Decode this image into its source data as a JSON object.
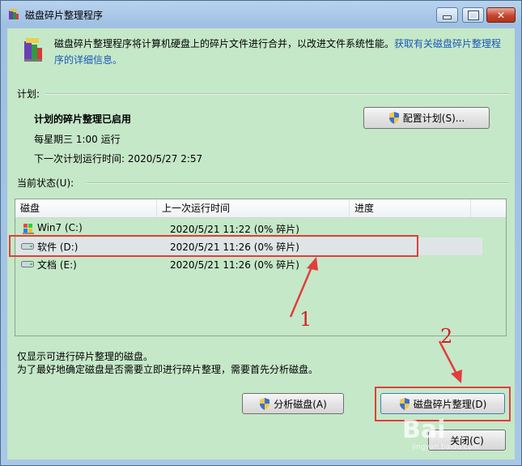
{
  "window": {
    "title": "磁盘碎片整理程序"
  },
  "description": {
    "text": "磁盘碎片整理程序将计算机硬盘上的碎片文件进行合并，以改进文件系统性能。",
    "link": "获取有关磁盘碎片整理程序的详细信息。"
  },
  "schedule": {
    "section_label": "计划:",
    "status": "计划的碎片整理已启用",
    "frequency": "每星期三  1:00 运行",
    "next_run": "下一次计划运行时间: 2020/5/27 2:57",
    "configure_button": "配置计划(S)..."
  },
  "current_status": {
    "section_label": "当前状态(U):",
    "columns": [
      "磁盘",
      "上一次运行时间",
      "进度"
    ],
    "rows": [
      {
        "disk": "Win7 (C:)",
        "last_run": "2020/5/21 11:22 (0% 碎片)",
        "progress": ""
      },
      {
        "disk": "软件 (D:)",
        "last_run": "2020/5/21 11:26 (0% 碎片)",
        "progress": ""
      },
      {
        "disk": "文档 (E:)",
        "last_run": "2020/5/21 11:26 (0% 碎片)",
        "progress": ""
      }
    ],
    "selected_row": 1
  },
  "notes": {
    "line1": "仅显示可进行碎片整理的磁盘。",
    "line2": "为了最好地确定磁盘是否需要立即进行碎片整理，需要首先分析磁盘。"
  },
  "buttons": {
    "analyze": "分析磁盘(A)",
    "defrag": "磁盘碎片整理(D)",
    "close": "关闭(C)"
  },
  "annotations": {
    "one": "1",
    "two": "2"
  },
  "watermark": {
    "main": "Bai",
    "sub": "jingyan.baidu.com"
  },
  "colors": {
    "client_bg": "#c5e8c8",
    "annotation": "#e23d3d",
    "link": "#1a57b8"
  }
}
